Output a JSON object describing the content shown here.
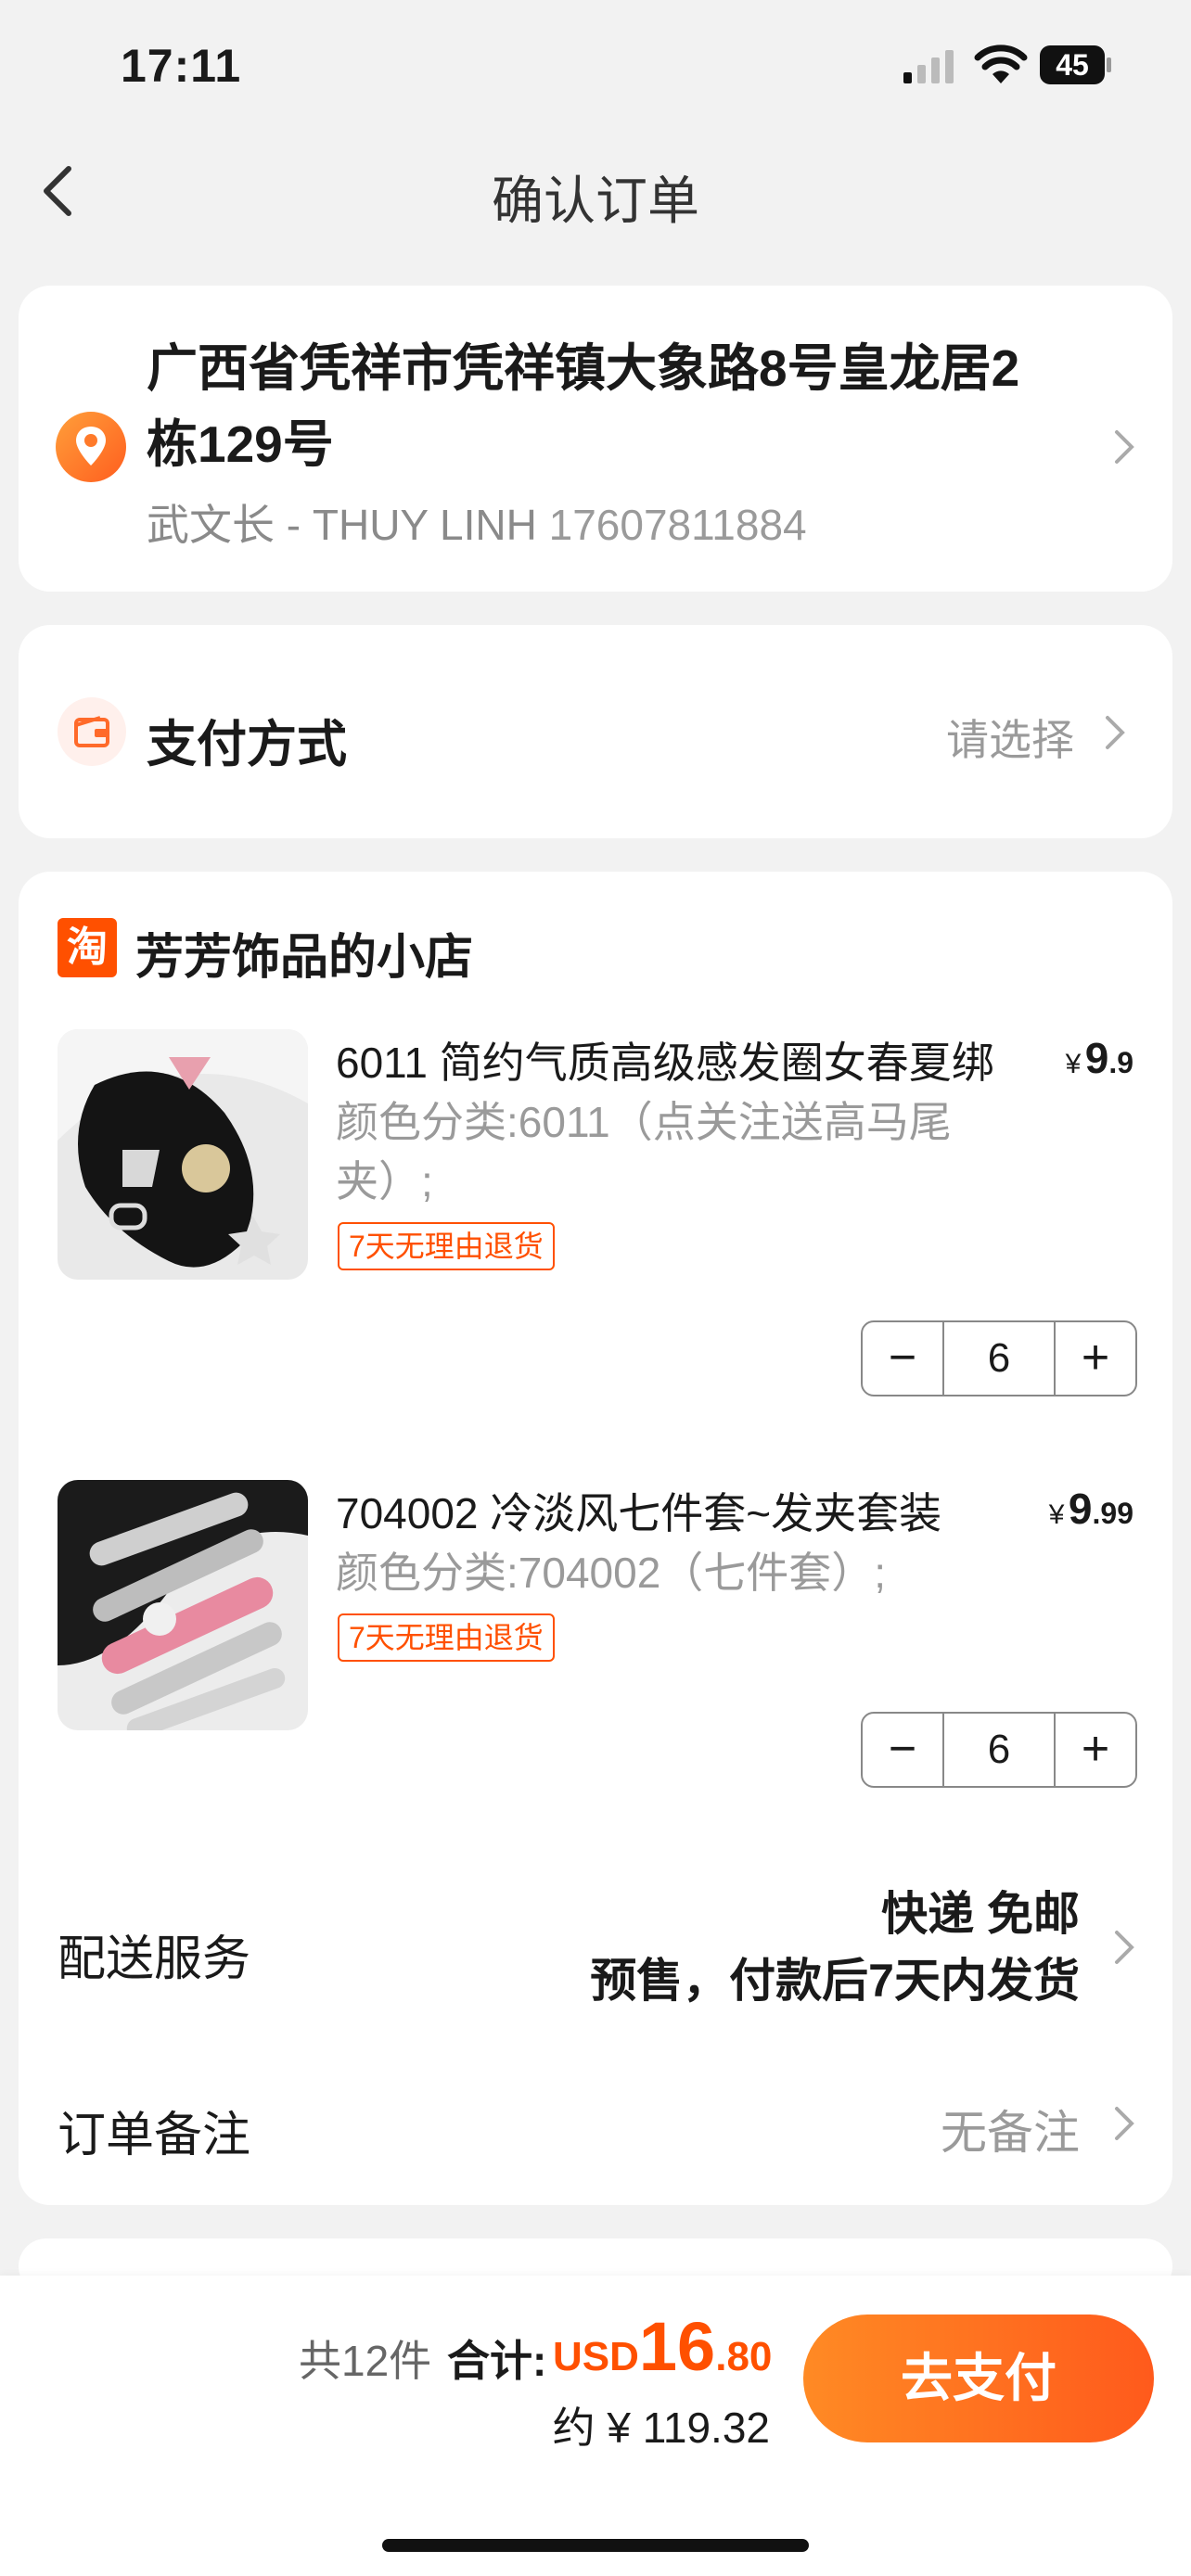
{
  "status_bar": {
    "time": "17:11",
    "battery": "45"
  },
  "nav": {
    "title": "确认订单"
  },
  "address": {
    "line": "广西省凭祥市凭祥镇大象路8号皇龙居2栋129号",
    "name": "武文长 - THUY LINH",
    "phone": "17607811884"
  },
  "payment": {
    "label": "支付方式",
    "value": "请选择"
  },
  "shop": {
    "logo_char": "淘",
    "name": "芳芳饰品的小店",
    "items": [
      {
        "title": "6011 简约气质高级感发圈女春夏绑",
        "sku": "颜色分类:6011（点关注送高马尾夹）;",
        "tag": "7天无理由退货",
        "price_symbol": "¥",
        "price_int": "9",
        "price_dec": ".9",
        "qty": "6"
      },
      {
        "title": "704002 冷淡风七件套~发夹套装",
        "sku": "颜色分类:704002（七件套）;",
        "tag": "7天无理由退货",
        "price_symbol": "¥",
        "price_int": "9",
        "price_dec": ".99",
        "qty": "6"
      }
    ],
    "stepper": {
      "minus": "−",
      "plus": "+"
    },
    "delivery": {
      "label": "配送服务",
      "line1": "快递 免邮",
      "line2": "预售，付款后7天内发货"
    },
    "remark": {
      "label": "订单备注",
      "value": "无备注"
    }
  },
  "footer": {
    "count": "共12件",
    "total_label": "合计:",
    "currency": "USD",
    "amount_int": "16",
    "amount_dec": ".80",
    "approx": "约 ¥ 119.32",
    "pay_button": "去支付"
  },
  "colors": {
    "accent": "#ff5000",
    "background": "#f2f2f2"
  }
}
